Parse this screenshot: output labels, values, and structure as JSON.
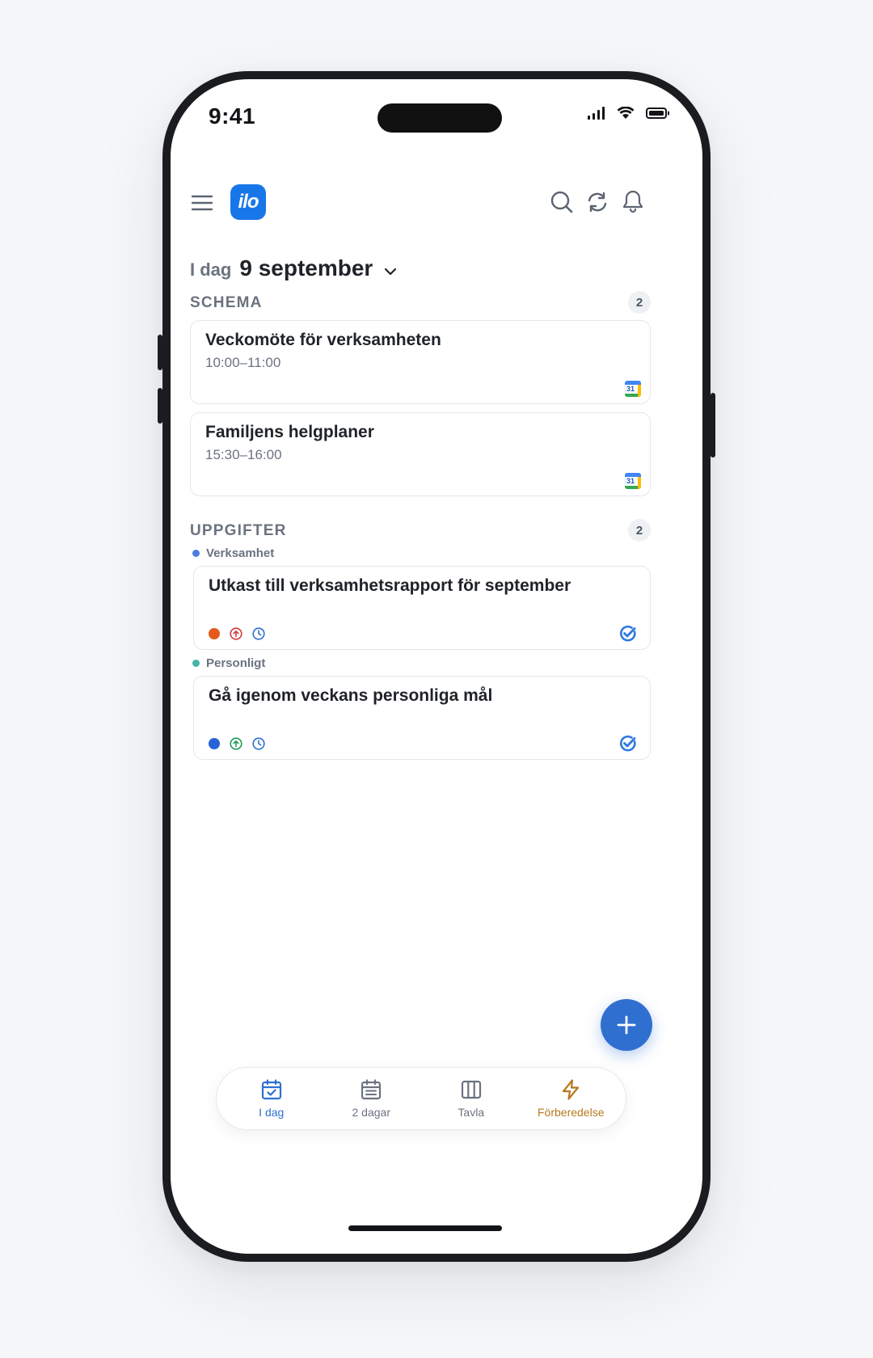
{
  "status_bar": {
    "time": "9:41"
  },
  "header": {
    "logo_text": "ilo",
    "icons": [
      "menu-icon",
      "search-icon",
      "sync-icon",
      "bell-icon"
    ]
  },
  "date": {
    "prefix": "I dag",
    "label": "9 september"
  },
  "schedule": {
    "title": "SCHEMA",
    "count": "2",
    "events": [
      {
        "title": "Veckomöte för verksamheten",
        "time": "10:00–11:00",
        "calendar_badge": "31"
      },
      {
        "title": "Familjens helgplaner",
        "time": "15:30–16:00",
        "calendar_badge": "31"
      }
    ]
  },
  "tasks": {
    "title": "UPPGIFTER",
    "count": "2",
    "groups": [
      {
        "label": "Verksamhet",
        "dot_color": "#4a7fe0",
        "task": {
          "title": "Utkast till verksamhetsrapport för september",
          "priority_color": "#e45a1b",
          "arrow_color": "#d23a3a"
        }
      },
      {
        "label": "Personligt",
        "dot_color": "#46b4a6",
        "task": {
          "title": "Gå igenom veckans personliga mål",
          "priority_color": "#2563d6",
          "arrow_color": "#1e9a5a"
        }
      }
    ]
  },
  "bottom_nav": {
    "items": [
      {
        "label": "I dag",
        "color": "#2f6fd0"
      },
      {
        "label": "2 dagar",
        "color": "#6b7280"
      },
      {
        "label": "Tavla",
        "color": "#6b7280"
      },
      {
        "label": "Förberedelse",
        "color": "#b7791f"
      }
    ]
  },
  "colors": {
    "accent": "#2f6fd0",
    "text_primary": "#1f2328",
    "text_secondary": "#6b7280",
    "card_border": "#e5e7eb",
    "check_blue": "#2f7be0"
  }
}
